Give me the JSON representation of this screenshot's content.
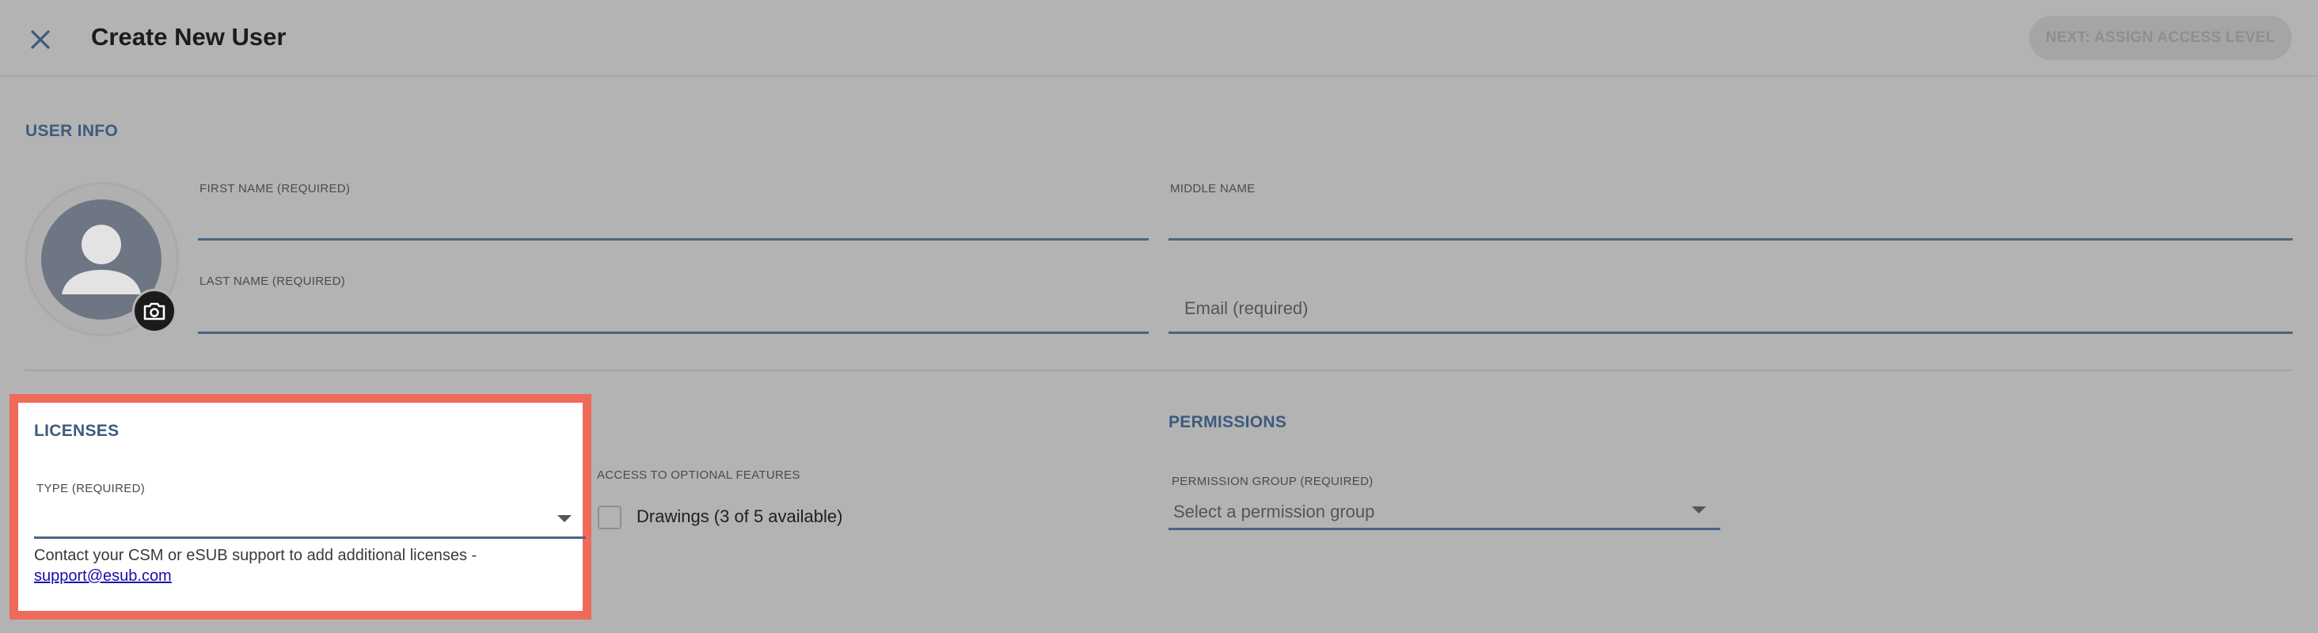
{
  "header": {
    "title": "Create New User",
    "next_button": "NEXT: ASSIGN ACCESS LEVEL"
  },
  "user_info": {
    "heading": "USER INFO",
    "first_name_label": "FIRST NAME (REQUIRED)",
    "middle_name_label": "MIDDLE NAME",
    "last_name_label": "LAST NAME (REQUIRED)",
    "email_placeholder": "Email (required)"
  },
  "licenses": {
    "heading": "LICENSES",
    "type_label": "TYPE (REQUIRED)",
    "help_text": "Contact your CSM or eSUB support to add additional licenses -",
    "support_link": "support@esub.com"
  },
  "optional_features": {
    "label": "ACCESS TO OPTIONAL FEATURES",
    "drawings_label": "Drawings (3 of 5 available)"
  },
  "permissions": {
    "heading": "PERMISSIONS",
    "group_label": "PERMISSION GROUP (REQUIRED)",
    "group_placeholder": "Select a permission group"
  },
  "colors": {
    "accent": "#3d5b7e",
    "highlight": "#ee6b5c",
    "backdrop": "#b3b3b3"
  },
  "icons": [
    "close-icon",
    "user-avatar-icon",
    "camera-icon",
    "caret-down-icon"
  ]
}
